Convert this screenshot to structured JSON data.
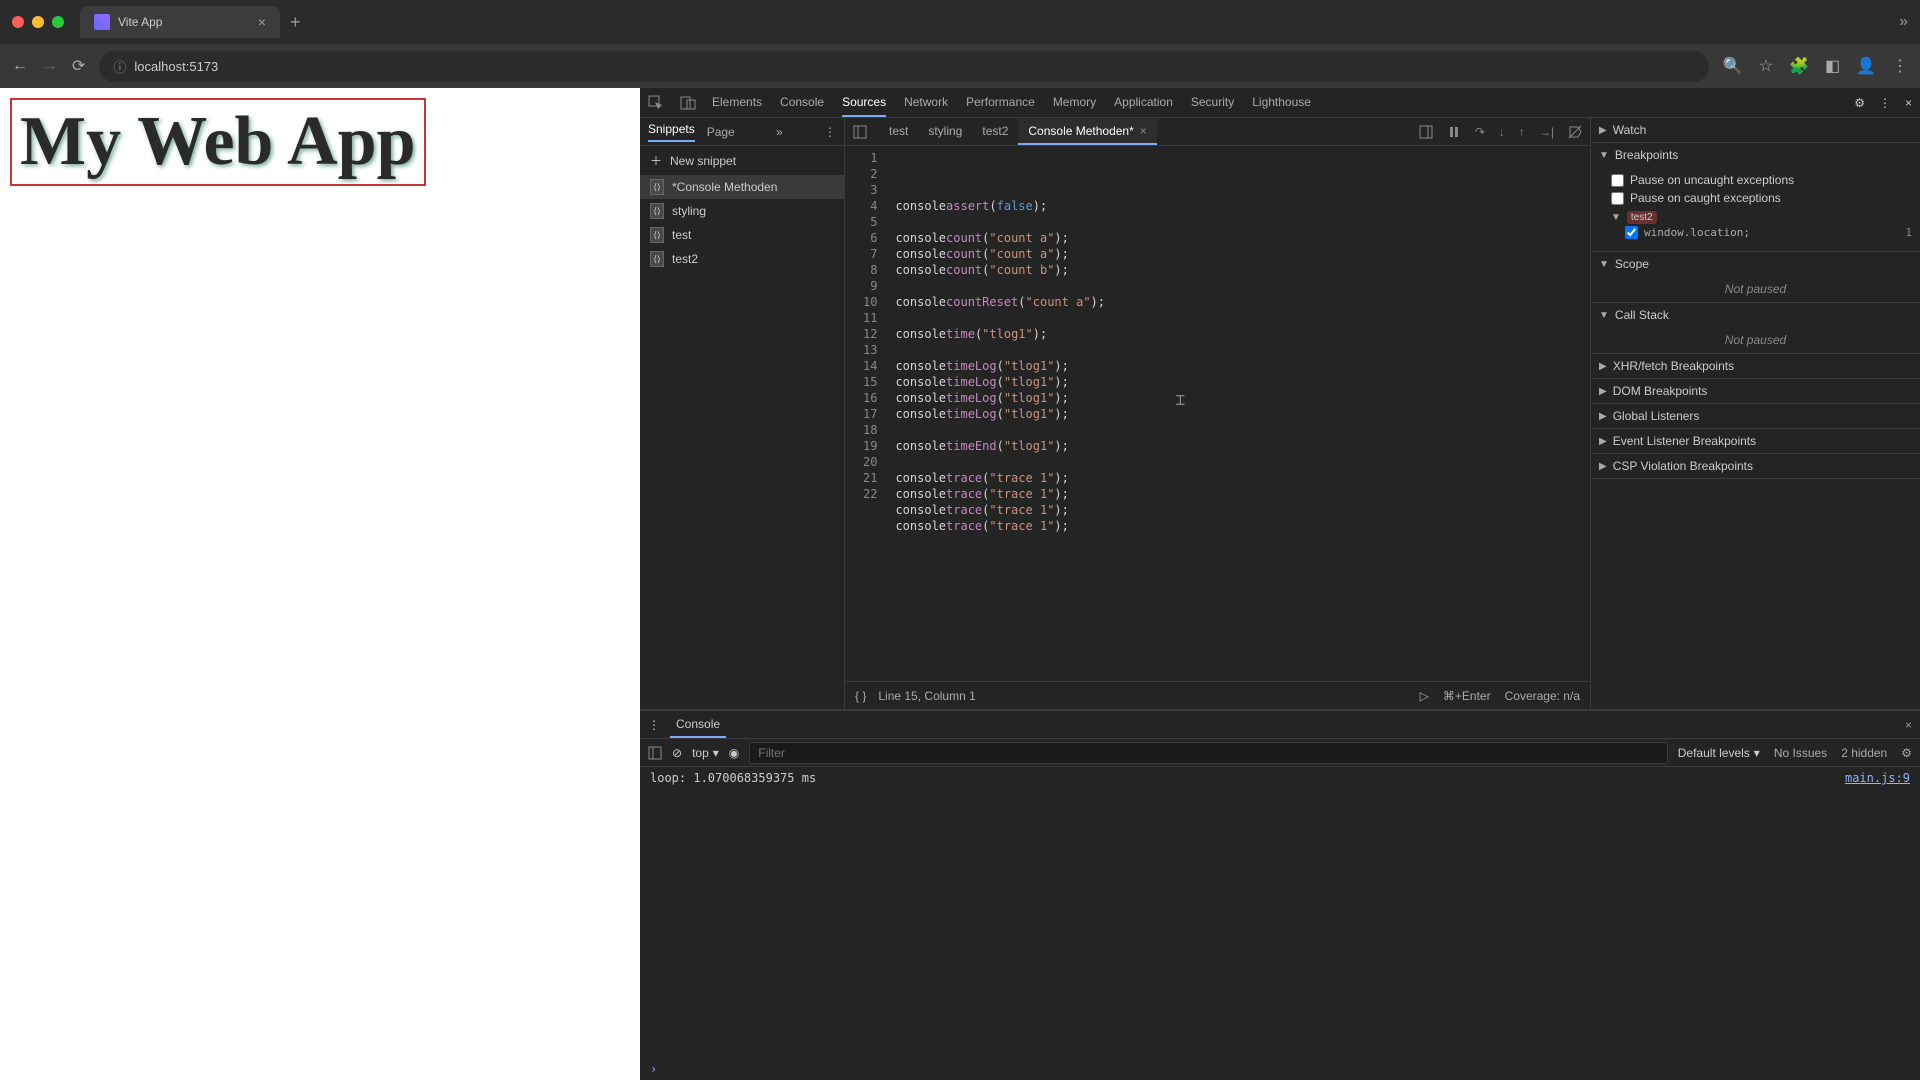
{
  "browser": {
    "tab_title": "Vite App",
    "url": "localhost:5173"
  },
  "page": {
    "heading": "My Web App"
  },
  "devtools": {
    "tabs": [
      "Elements",
      "Console",
      "Sources",
      "Network",
      "Performance",
      "Memory",
      "Application",
      "Security",
      "Lighthouse"
    ],
    "active_tab": "Sources",
    "navigator": {
      "tabs": [
        "Snippets",
        "Page"
      ],
      "active": "Snippets",
      "new_snippet_label": "New snippet",
      "snippets": [
        "*Console Methoden",
        "styling",
        "test",
        "test2"
      ],
      "selected": "*Console Methoden"
    },
    "editor": {
      "tabs": [
        {
          "name": "test",
          "active": false,
          "closable": false
        },
        {
          "name": "styling",
          "active": false,
          "closable": false
        },
        {
          "name": "test2",
          "active": false,
          "closable": false
        },
        {
          "name": "Console Methoden*",
          "active": true,
          "closable": true
        }
      ],
      "code_lines": [
        {
          "n": 1,
          "tokens": [
            [
              "",
              "console"
            ],
            [
              ".",
              ""
            ],
            [
              "method",
              "assert"
            ],
            [
              "",
              "("
            ],
            [
              "bool",
              "false"
            ],
            [
              "",
              ");"
            ]
          ]
        },
        {
          "n": 2,
          "tokens": []
        },
        {
          "n": 3,
          "tokens": [
            [
              "",
              "console"
            ],
            [
              ".",
              ""
            ],
            [
              "method",
              "count"
            ],
            [
              "",
              "("
            ],
            [
              "str",
              "\"count a\""
            ],
            [
              "",
              ");"
            ]
          ]
        },
        {
          "n": 4,
          "tokens": [
            [
              "",
              "console"
            ],
            [
              ".",
              ""
            ],
            [
              "method",
              "count"
            ],
            [
              "",
              "("
            ],
            [
              "str",
              "\"count a\""
            ],
            [
              "",
              ");"
            ]
          ]
        },
        {
          "n": 5,
          "tokens": [
            [
              "",
              "console"
            ],
            [
              ".",
              ""
            ],
            [
              "method",
              "count"
            ],
            [
              "",
              "("
            ],
            [
              "str",
              "\"count b\""
            ],
            [
              "",
              ");"
            ]
          ]
        },
        {
          "n": 6,
          "tokens": []
        },
        {
          "n": 7,
          "tokens": [
            [
              "",
              "console"
            ],
            [
              ".",
              ""
            ],
            [
              "method",
              "countReset"
            ],
            [
              "",
              "("
            ],
            [
              "str",
              "\"count a\""
            ],
            [
              "",
              ");"
            ]
          ]
        },
        {
          "n": 8,
          "tokens": []
        },
        {
          "n": 9,
          "tokens": [
            [
              "",
              "console"
            ],
            [
              ".",
              ""
            ],
            [
              "method",
              "time"
            ],
            [
              "",
              "("
            ],
            [
              "str",
              "\"tlog1\""
            ],
            [
              "",
              ");"
            ]
          ]
        },
        {
          "n": 10,
          "tokens": []
        },
        {
          "n": 11,
          "tokens": [
            [
              "",
              "console"
            ],
            [
              ".",
              ""
            ],
            [
              "method",
              "timeLog"
            ],
            [
              "",
              "("
            ],
            [
              "str",
              "\"tlog1\""
            ],
            [
              "",
              ");"
            ]
          ]
        },
        {
          "n": 12,
          "tokens": [
            [
              "",
              "console"
            ],
            [
              ".",
              ""
            ],
            [
              "method",
              "timeLog"
            ],
            [
              "",
              "("
            ],
            [
              "str",
              "\"tlog1\""
            ],
            [
              "",
              ");"
            ]
          ]
        },
        {
          "n": 13,
          "tokens": [
            [
              "",
              "console"
            ],
            [
              ".",
              ""
            ],
            [
              "method",
              "timeLog"
            ],
            [
              "",
              "("
            ],
            [
              "str",
              "\"tlog1\""
            ],
            [
              "",
              ");"
            ]
          ]
        },
        {
          "n": 14,
          "tokens": [
            [
              "",
              "console"
            ],
            [
              ".",
              ""
            ],
            [
              "method",
              "timeLog"
            ],
            [
              "",
              "("
            ],
            [
              "str",
              "\"tlog1\""
            ],
            [
              "",
              ");"
            ]
          ]
        },
        {
          "n": 15,
          "tokens": []
        },
        {
          "n": 16,
          "tokens": [
            [
              "",
              "console"
            ],
            [
              ".",
              ""
            ],
            [
              "method",
              "timeEnd"
            ],
            [
              "",
              "("
            ],
            [
              "str",
              "\"tlog1\""
            ],
            [
              "",
              ");"
            ]
          ]
        },
        {
          "n": 17,
          "tokens": []
        },
        {
          "n": 18,
          "tokens": [
            [
              "",
              "console"
            ],
            [
              ".",
              ""
            ],
            [
              "method",
              "trace"
            ],
            [
              "",
              "("
            ],
            [
              "str",
              "\"trace 1\""
            ],
            [
              "",
              ");"
            ]
          ]
        },
        {
          "n": 19,
          "tokens": [
            [
              "",
              "console"
            ],
            [
              ".",
              ""
            ],
            [
              "method",
              "trace"
            ],
            [
              "",
              "("
            ],
            [
              "str",
              "\"trace 1\""
            ],
            [
              "",
              ");"
            ]
          ]
        },
        {
          "n": 20,
          "tokens": [
            [
              "",
              "console"
            ],
            [
              ".",
              ""
            ],
            [
              "method",
              "trace"
            ],
            [
              "",
              "("
            ],
            [
              "str",
              "\"trace 1\""
            ],
            [
              "",
              ");"
            ]
          ]
        },
        {
          "n": 21,
          "tokens": [
            [
              "",
              "console"
            ],
            [
              ".",
              ""
            ],
            [
              "method",
              "trace"
            ],
            [
              "",
              "("
            ],
            [
              "str",
              "\"trace 1\""
            ],
            [
              "",
              ");"
            ]
          ]
        },
        {
          "n": 22,
          "tokens": []
        }
      ],
      "footer": {
        "cursor_pos": "Line 15, Column 1",
        "run_shortcut": "⌘+Enter",
        "coverage": "Coverage: n/a"
      }
    },
    "debugger": {
      "sections": {
        "watch": "Watch",
        "breakpoints": "Breakpoints",
        "scope": "Scope",
        "call_stack": "Call Stack",
        "xhr": "XHR/fetch Breakpoints",
        "dom": "DOM Breakpoints",
        "global": "Global Listeners",
        "event": "Event Listener Breakpoints",
        "csp": "CSP Violation Breakpoints"
      },
      "pause_uncaught": "Pause on uncaught exceptions",
      "pause_caught": "Pause on caught exceptions",
      "bp_group_name": "test2",
      "bp_entry_code": "window.location;",
      "bp_entry_line": "1",
      "not_paused": "Not paused"
    },
    "console_drawer": {
      "tab": "Console",
      "context": "top",
      "filter_placeholder": "Filter",
      "levels": "Default levels",
      "issues": "No Issues",
      "hidden": "2 hidden",
      "log_msg": "loop: 1.070068359375 ms",
      "log_src": "main.js:9"
    }
  }
}
